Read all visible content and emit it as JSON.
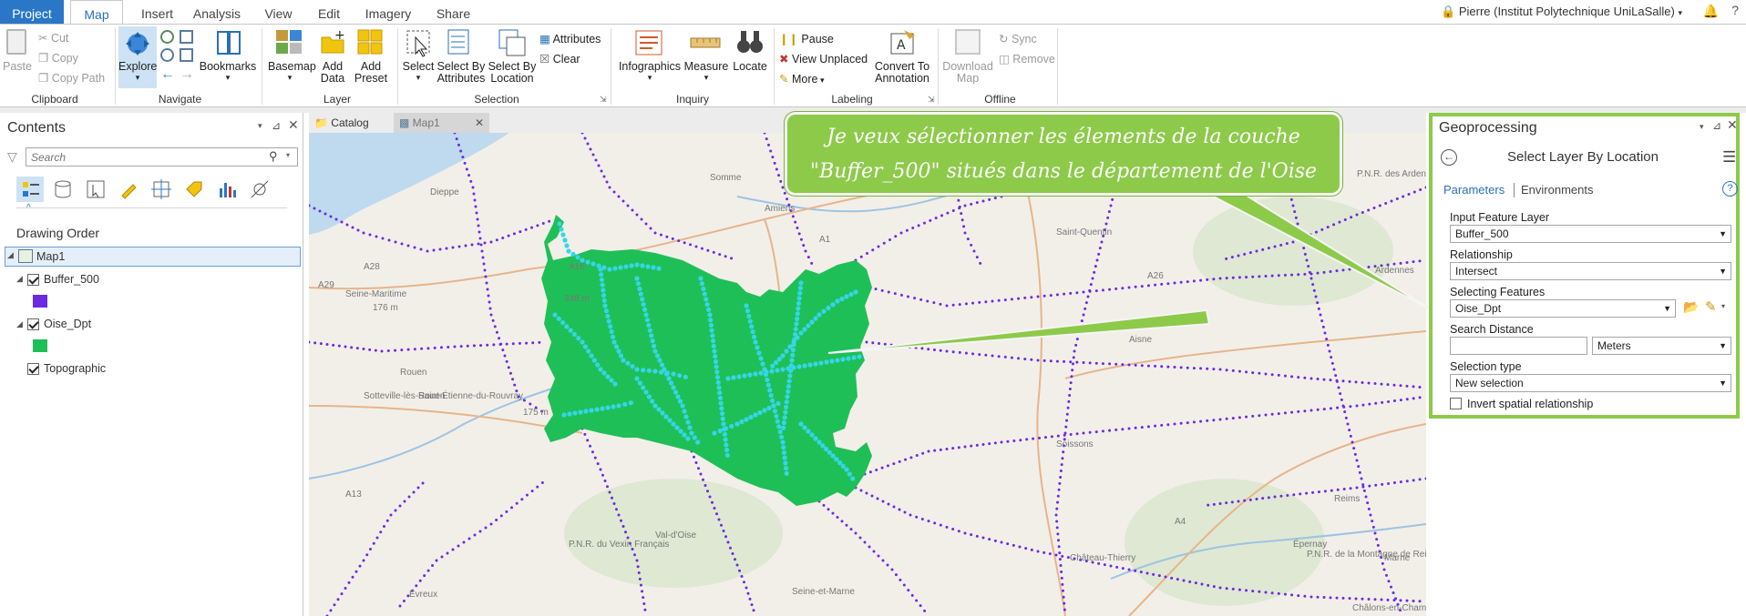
{
  "tabs": [
    "Project",
    "Map",
    "Insert",
    "Analysis",
    "View",
    "Edit",
    "Imagery",
    "Share"
  ],
  "user": "Pierre (Institut Polytechnique UniLaSalle)",
  "ribbon": {
    "clipboard": {
      "label": "Clipboard",
      "paste": "Paste",
      "cut": "Cut",
      "copy": "Copy",
      "copy_path": "Copy Path"
    },
    "navigate": {
      "label": "Navigate",
      "explore": "Explore",
      "bookmarks": "Bookmarks"
    },
    "layer": {
      "label": "Layer",
      "basemap": "Basemap",
      "add_data": "Add\nData",
      "add_preset": "Add\nPreset"
    },
    "selection": {
      "label": "Selection",
      "select": "Select",
      "select_by_attributes": "Select By\nAttributes",
      "select_by_location": "Select By\nLocation",
      "attributes": "Attributes",
      "clear": "Clear"
    },
    "inquiry": {
      "label": "Inquiry",
      "infographics": "Infographics",
      "measure": "Measure",
      "locate": "Locate"
    },
    "labeling": {
      "label": "Labeling",
      "pause": "Pause",
      "view_unplaced": "View Unplaced",
      "more": "More",
      "convert": "Convert To\nAnnotation"
    },
    "offline": {
      "label": "Offline",
      "download_map": "Download\nMap",
      "sync": "Sync",
      "remove": "Remove"
    }
  },
  "contents": {
    "title": "Contents",
    "search_placeholder": "Search",
    "drawing_order": "Drawing Order",
    "map": "Map1",
    "layers": [
      {
        "name": "Buffer_500",
        "color": "#6a2be0"
      },
      {
        "name": "Oise_Dpt",
        "color": "#1fbf57"
      },
      {
        "name": "Topographic"
      }
    ]
  },
  "view_tabs": [
    "Catalog",
    "Map1"
  ],
  "map_labels": [
    "Dieppe",
    "Amiens",
    "Somme",
    "Saint-Quentin",
    "P.N.R. des Ardennes",
    "Ardennes",
    "Seine-Maritime",
    "Rouen",
    "Sotteville-lès-Rouen",
    "Saint-Étienne-du-Rouvray",
    "P.N.R. de la Montagne de Reims",
    "Reims",
    "Soissons",
    "P.N.R. du Vexin Français",
    "Val-d'Oise",
    "Seine-et-Marne",
    "Château-Thierry",
    "Épernay",
    "Châlons-en-Champagne",
    "Évreux",
    "Marne",
    "Aisne",
    "A28",
    "A29",
    "A16",
    "A1",
    "A26",
    "A4",
    "A13",
    "176 m",
    "248 m",
    "175 m"
  ],
  "callout": {
    "line1": "Je veux sélectionner les élements de la couche",
    "line2": "\"Buffer_500\" situés dans le département de l'Oise"
  },
  "geoprocessing": {
    "title": "Geoprocessing",
    "tool": "Select Layer By Location",
    "tab_parameters": "Parameters",
    "tab_environments": "Environments",
    "input_label": "Input Feature Layer",
    "input_value": "Buffer_500",
    "relationship_label": "Relationship",
    "relationship_value": "Intersect",
    "selecting_label": "Selecting Features",
    "selecting_value": "Oise_Dpt",
    "distance_label": "Search Distance",
    "distance_value": "",
    "distance_unit": "Meters",
    "seltype_label": "Selection type",
    "seltype_value": "New selection",
    "invert_label": "Invert spatial relationship"
  }
}
